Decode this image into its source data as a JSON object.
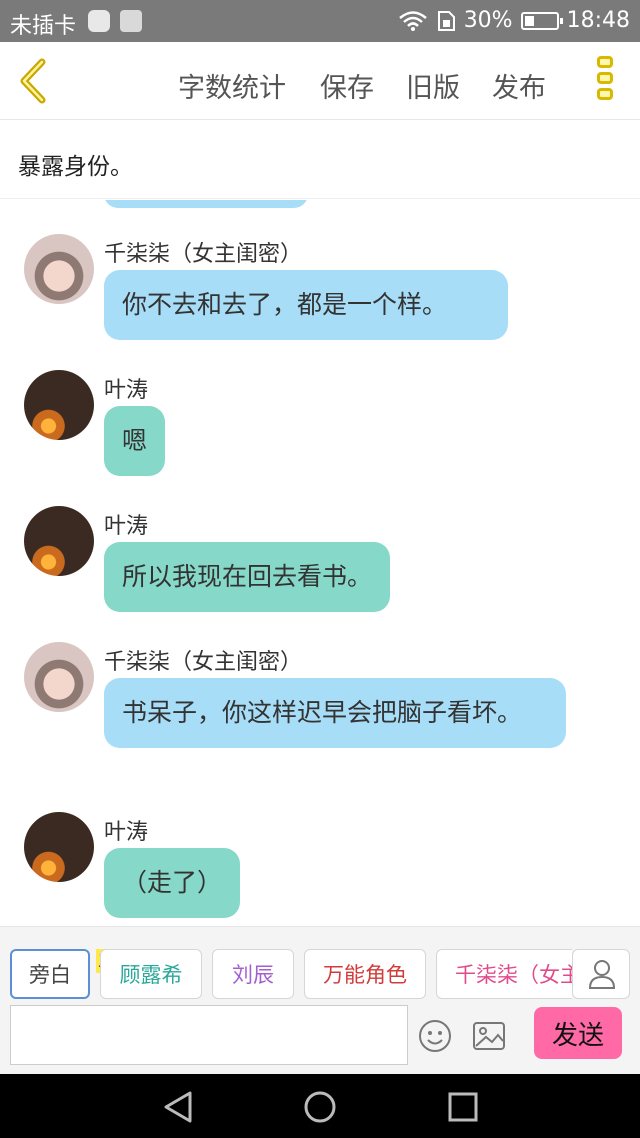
{
  "status_bar": {
    "carrier": "未插卡",
    "battery": "30%",
    "time": "18:48",
    "battery_level": 0.3
  },
  "toolbar": {
    "items": [
      "字数统计",
      "保存",
      "旧版",
      "发布"
    ]
  },
  "scene": {
    "text": "暴露身份。"
  },
  "messages": [
    {
      "name": "千柒柒（女主闺密）",
      "text": "你不去和去了，都是一个样。",
      "avatar": "girl",
      "color": "blue"
    },
    {
      "name": "叶涛",
      "text": "嗯",
      "avatar": "boy",
      "color": "green"
    },
    {
      "name": "叶涛",
      "text": "所以我现在回去看书。",
      "avatar": "boy",
      "color": "green"
    },
    {
      "name": "千柒柒（女主闺密）",
      "text": "书呆子，你这样迟早会把脑子看坏。",
      "avatar": "girl",
      "color": "blue"
    },
    {
      "name": "叶涛",
      "text": "（走了）",
      "avatar": "boy",
      "color": "green"
    }
  ],
  "roles": {
    "badge": "主",
    "items": [
      {
        "label": "旁白",
        "color": "#444444"
      },
      {
        "label": "顾露希",
        "color": "#2aa89a"
      },
      {
        "label": "刘辰",
        "color": "#a35fd1"
      },
      {
        "label": "万能角色",
        "color": "#d23b3b"
      },
      {
        "label": "千柒柒（女主",
        "color": "#e04c8b"
      }
    ]
  },
  "composer": {
    "input_placeholder": "",
    "send_label": "发送"
  },
  "colors": {
    "accent_yellow": "#d9b800",
    "bubble_blue": "#a7ddf7",
    "bubble_green": "#86d8c8",
    "send_pink": "#ff6aa6"
  }
}
